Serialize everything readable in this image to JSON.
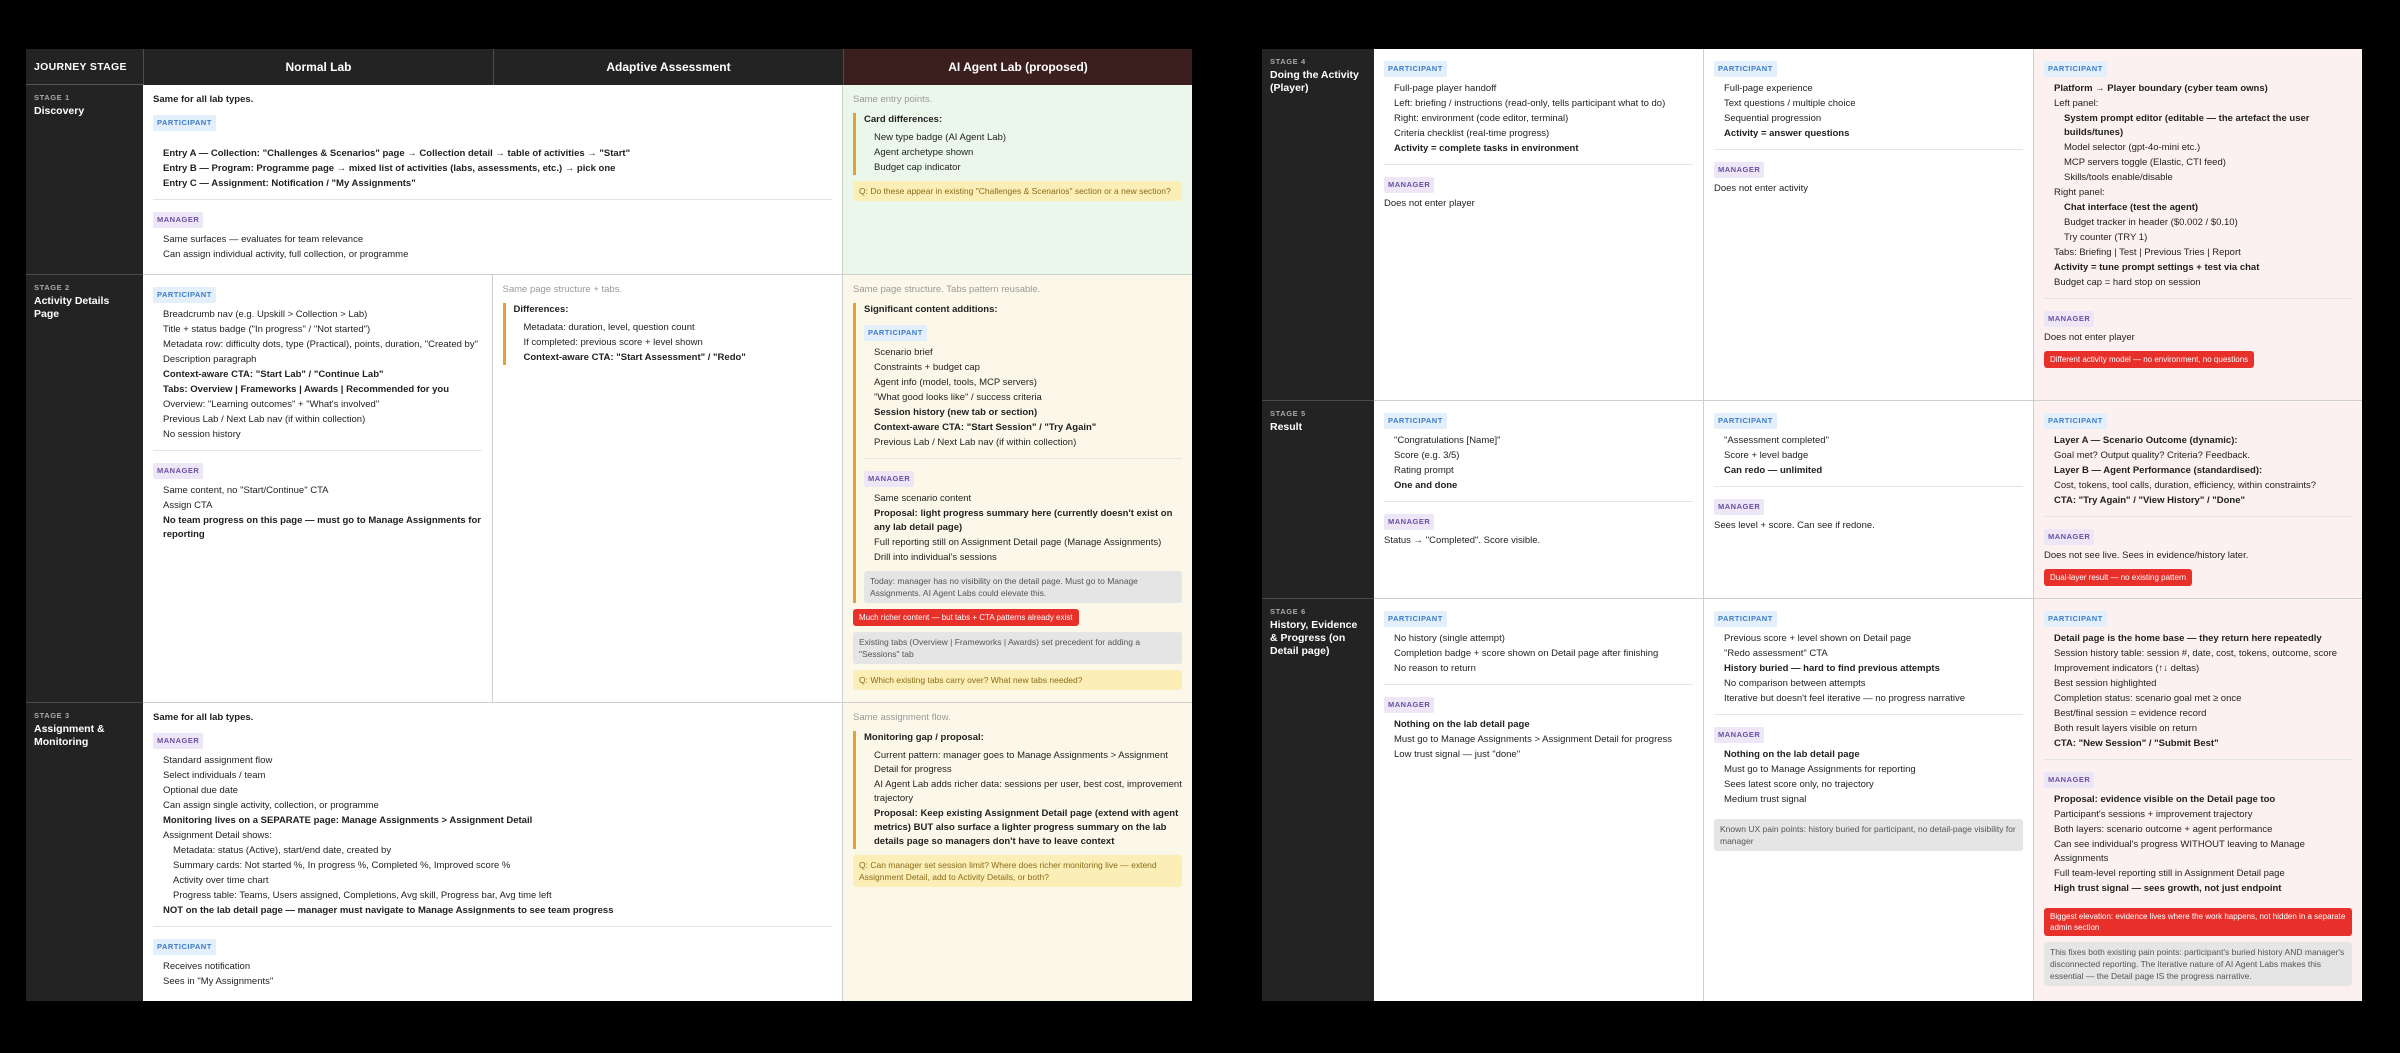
{
  "left": {
    "journey_stage": "JOURNEY STAGE",
    "columns": [
      "Normal Lab",
      "Adaptive Assessment",
      "AI Agent Lab (proposed)"
    ],
    "stages": [
      {
        "num": "STAGE 1",
        "title": "Discovery"
      },
      {
        "num": "STAGE 2",
        "title": "Activity Details Page"
      },
      {
        "num": "STAGE 3",
        "title": "Assignment & Monitoring"
      }
    ],
    "s1": {
      "normal_intro": "Same for all lab types.",
      "participant": "PARTICIPANT",
      "manager": "MANAGER",
      "normal_p": [
        "Entry A — Collection: \"Challenges & Scenarios\" page → Collection detail → table of activities → \"Start\"",
        "Entry B — Program: Programme page → mixed list of activities (labs, assessments, etc.) → pick one",
        "Entry C — Assignment: Notification / \"My Assignments\""
      ],
      "normal_m": [
        "Same surfaces — evaluates for team relevance",
        "Can assign individual activity, full collection, or programme"
      ],
      "ai_intro": "Same entry points.",
      "ai_sub": "Card differences:",
      "ai_items": [
        "New type badge (AI Agent Lab)",
        "Agent archetype shown",
        "Budget cap indicator"
      ],
      "ai_q": "Q: Do these appear in existing \"Challenges & Scenarios\" section or a new section?"
    },
    "s2": {
      "normal_p": [
        "Breadcrumb nav (e.g. Upskill > Collection > Lab)",
        "Title + status badge (\"In progress\" / \"Not started\")",
        "Metadata row: difficulty dots, type (Practical), points, duration, \"Created by\"",
        "Description paragraph",
        "Context-aware CTA: \"Start Lab\" / \"Continue Lab\"",
        "Tabs: Overview | Frameworks | Awards | Recommended for you",
        "Overview: \"Learning outcomes\" + \"What's involved\"",
        "Previous Lab / Next Lab nav (if within collection)",
        "No session history"
      ],
      "normal_m": [
        "Same content, no \"Start/Continue\" CTA",
        "Assign CTA",
        "No team progress on this page — must go to Manage Assignments for reporting"
      ],
      "adaptive_intro": "Same page structure + tabs.",
      "adaptive_sub": "Differences:",
      "adaptive_items": [
        "Metadata: duration, level, question count",
        "If completed: previous score + level shown",
        "Context-aware CTA: \"Start Assessment\" / \"Redo\""
      ],
      "ai_intro": "Same page structure. Tabs pattern reusable.",
      "ai_sub": "Significant content additions:",
      "ai_p": [
        "Scenario brief",
        "Constraints + budget cap",
        "Agent info (model, tools, MCP servers)",
        "\"What good looks like\" / success criteria",
        "Session history (new tab or section)",
        "Context-aware CTA: \"Start Session\" / \"Try Again\"",
        "Previous Lab / Next Lab nav (if within collection)"
      ],
      "ai_m": [
        "Same scenario content",
        "Proposal: light progress summary here (currently doesn't exist on any lab detail page)",
        "Full reporting still on Assignment Detail page (Manage Assignments)",
        "Drill into individual's sessions"
      ],
      "ai_note": "Today: manager has no visibility on the detail page. Must go to Manage Assignments. AI Agent Labs could elevate this.",
      "ai_red": "Much richer content — but tabs + CTA patterns already exist",
      "ai_grey": "Existing tabs (Overview | Frameworks | Awards) set precedent for adding a \"Sessions\" tab",
      "ai_q": "Q: Which existing tabs carry over? What new tabs needed?"
    },
    "s3": {
      "normal_intro": "Same for all lab types.",
      "normal_m": [
        "Standard assignment flow",
        "Select individuals / team",
        "Optional due date",
        "Can assign single activity, collection, or programme",
        "Monitoring lives on a SEPARATE page: Manage Assignments > Assignment Detail",
        "Assignment Detail shows:",
        "Metadata: status (Active), start/end date, created by",
        "Summary cards: Not started %, In progress %, Completed %, Improved score %",
        "Activity over time chart",
        "Progress table: Teams, Users assigned, Completions, Avg skill, Progress bar, Avg time left",
        "NOT on the lab detail page — manager must navigate to Manage Assignments to see team progress"
      ],
      "normal_p": [
        "Receives notification",
        "Sees in \"My Assignments\""
      ],
      "ai_intro": "Same assignment flow.",
      "ai_sub": "Monitoring gap / proposal:",
      "ai_items": [
        "Current pattern: manager goes to Manage Assignments > Assignment Detail for progress",
        "AI Agent Lab adds richer data: sessions per user, best cost, improvement trajectory",
        "Proposal: Keep existing Assignment Detail page (extend with agent metrics) BUT also surface a lighter progress summary on the lab details page so managers don't have to leave context"
      ],
      "ai_q": "Q: Can manager set session limit? Where does richer monitoring live — extend Assignment Detail, add to Activity Details, or both?"
    }
  },
  "right": {
    "stages": [
      {
        "num": "STAGE 4",
        "title": "Doing the Activity (Player)"
      },
      {
        "num": "STAGE 5",
        "title": "Result"
      },
      {
        "num": "STAGE 6",
        "title": "History, Evidence & Progress (on Detail page)"
      }
    ],
    "s4": {
      "normal_p": [
        "Full-page player handoff",
        "Left: briefing / instructions (read-only, tells participant what to do)",
        "Right: environment (code editor, terminal)",
        "Criteria checklist (real-time progress)",
        "Activity = complete tasks in environment"
      ],
      "normal_m": "Does not enter player",
      "adaptive_p": [
        "Full-page experience",
        "Text questions / multiple choice",
        "Sequential progression",
        "Activity = answer questions"
      ],
      "adaptive_m": "Does not enter activity",
      "ai_p": [
        "Platform → Player boundary (cyber team owns)",
        "Left panel:",
        "System prompt editor (editable — the artefact the user builds/tunes)",
        "Model selector (gpt-4o-mini etc.)",
        "MCP servers toggle (Elastic, CTI feed)",
        "Skills/tools enable/disable",
        "Right panel:",
        "Chat interface (test the agent)",
        "Budget tracker in header ($0.002 / $0.10)",
        "Try counter (TRY 1)",
        "Tabs: Briefing | Test | Previous Tries | Report",
        "Activity = tune prompt settings + test via chat",
        "Budget cap = hard stop on session"
      ],
      "ai_m": "Does not enter player",
      "ai_red": "Different activity model — no environment, no questions"
    },
    "s5": {
      "normal_p": [
        "\"Congratulations [Name]\"",
        "Score (e.g. 3/5)",
        "Rating prompt",
        "One and done"
      ],
      "normal_m": "Status → \"Completed\". Score visible.",
      "adaptive_p": [
        "\"Assessment completed\"",
        "Score + level badge",
        "Can redo — unlimited"
      ],
      "adaptive_m": "Sees level + score. Can see if redone.",
      "ai_p": [
        "Layer A — Scenario Outcome (dynamic):",
        "Goal met? Output quality? Criteria? Feedback.",
        "Layer B — Agent Performance (standardised):",
        "Cost, tokens, tool calls, duration, efficiency, within constraints?",
        "CTA: \"Try Again\" / \"View History\" / \"Done\""
      ],
      "ai_m": "Does not see live. Sees in evidence/history later.",
      "ai_red": "Dual-layer result — no existing pattern"
    },
    "s6": {
      "normal_p": [
        "No history (single attempt)",
        "Completion badge + score shown on Detail page after finishing",
        "No reason to return"
      ],
      "normal_m": [
        "Nothing on the lab detail page",
        "Must go to Manage Assignments > Assignment Detail for progress",
        "Low trust signal — just \"done\""
      ],
      "adaptive_p": [
        "Previous score + level shown on Detail page",
        "\"Redo assessment\" CTA",
        "History buried — hard to find previous attempts",
        "No comparison between attempts",
        "Iterative but doesn't feel iterative — no progress narrative"
      ],
      "adaptive_m": [
        "Nothing on the lab detail page",
        "Must go to Manage Assignments for reporting",
        "Sees latest score only, no trajectory",
        "Medium trust signal"
      ],
      "adaptive_note": "Known UX pain points: history buried for participant, no detail-page visibility for manager",
      "ai_p": [
        "Detail page is the home base — they return here repeatedly",
        "Session history table: session #, date, cost, tokens, outcome, score",
        "Improvement indicators (↑↓ deltas)",
        "Best session highlighted",
        "Completion status: scenario goal met ≥ once",
        "Best/final session = evidence record",
        "Both result layers visible on return",
        "CTA: \"New Session\" / \"Submit Best\""
      ],
      "ai_m": [
        "Proposal: evidence visible on the Detail page too",
        "Participant's sessions + improvement trajectory",
        "Both layers: scenario outcome + agent performance",
        "Can see individual's progress WITHOUT leaving to Manage Assignments",
        "Full team-level reporting still in Assignment Detail page",
        "High trust signal — sees growth, not just endpoint"
      ],
      "ai_red": "Biggest elevation: evidence lives where the work happens, not hidden in a separate admin section",
      "ai_note": "This fixes both existing pain points: participant's buried history AND manager's disconnected reporting. The iterative nature of AI Agent Labs makes this essential — the Detail page IS the progress narrative."
    }
  },
  "labels": {
    "participant": "PARTICIPANT",
    "manager": "MANAGER"
  },
  "colors": {
    "dark": "#232323",
    "proposed_header": "#3b1f1f",
    "green_cell": "#ecf7ec",
    "yellow_cell": "#fcf8e9",
    "pink_cell": "#fdf0f0",
    "red_callout": "#e8302b"
  }
}
